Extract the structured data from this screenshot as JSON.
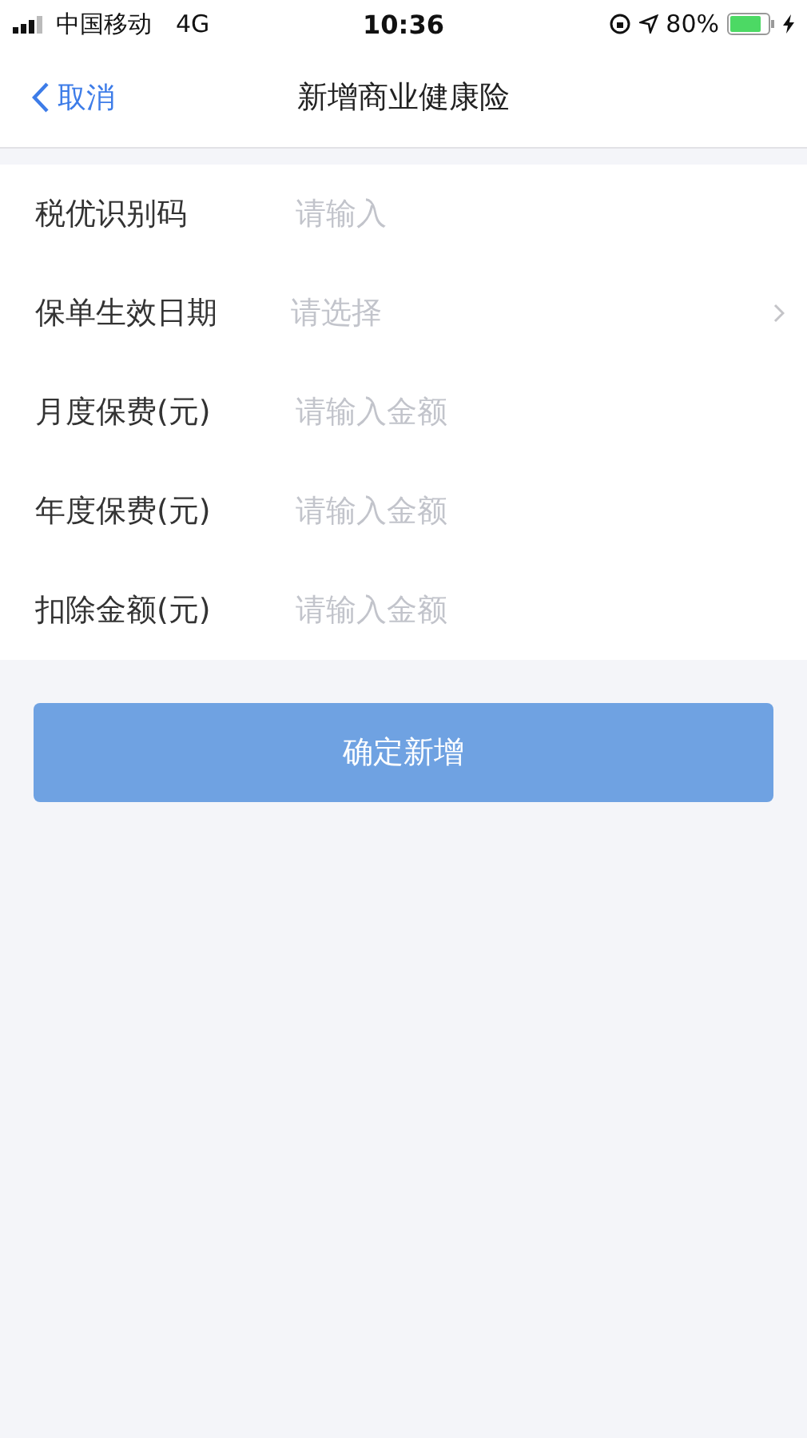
{
  "status_bar": {
    "carrier": "中国移动",
    "network": "4G",
    "time": "10:36",
    "battery": "80%"
  },
  "nav": {
    "back": "取消",
    "title": "新增商业健康险"
  },
  "fields": [
    {
      "kind": "input",
      "label": "税优识别码",
      "placeholder": "请输入"
    },
    {
      "kind": "select",
      "label": "保单生效日期",
      "placeholder": "请选择"
    },
    {
      "kind": "input",
      "label": "月度保费(元)",
      "placeholder": "请输入金额"
    },
    {
      "kind": "input",
      "label": "年度保费(元)",
      "placeholder": "请输入金额"
    },
    {
      "kind": "input",
      "label": "扣除金额(元)",
      "placeholder": "请输入金额"
    }
  ],
  "submit": {
    "label": "确定新增",
    "disabled": true
  }
}
